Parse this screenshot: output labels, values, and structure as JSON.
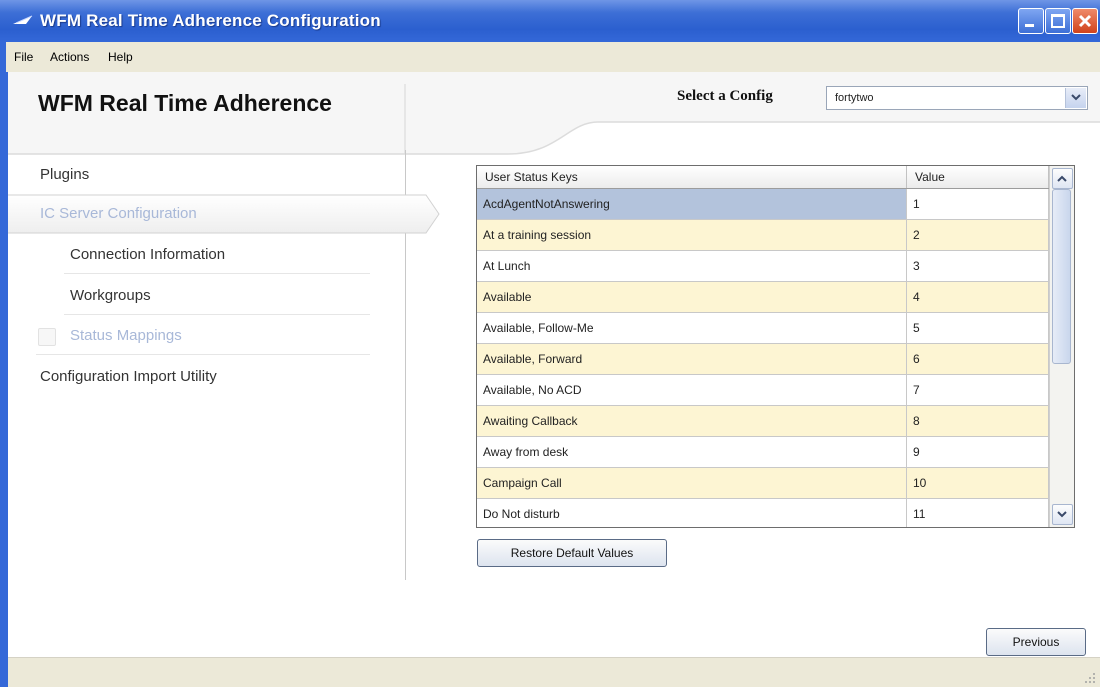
{
  "window": {
    "title": "WFM Real Time Adherence Configuration"
  },
  "menu": {
    "items": [
      "File",
      "Actions",
      "Help"
    ]
  },
  "header": {
    "title": "WFM Real Time Adherence",
    "select_label": "Select a Config",
    "config_value": "fortytwo"
  },
  "sidebar": {
    "items": [
      {
        "label": "Plugins"
      },
      {
        "label": "IC Server Configuration"
      },
      {
        "label": "Connection Information"
      },
      {
        "label": "Workgroups"
      },
      {
        "label": "Status Mappings"
      },
      {
        "label": "Configuration Import Utility"
      }
    ]
  },
  "table": {
    "columns": [
      "User Status Keys",
      "Value"
    ],
    "rows": [
      {
        "key": "AcdAgentNotAnswering",
        "value": "1"
      },
      {
        "key": "At a training session",
        "value": "2"
      },
      {
        "key": "At Lunch",
        "value": "3"
      },
      {
        "key": "Available",
        "value": "4"
      },
      {
        "key": "Available, Follow-Me",
        "value": "5"
      },
      {
        "key": "Available, Forward",
        "value": "6"
      },
      {
        "key": "Available, No ACD",
        "value": "7"
      },
      {
        "key": "Awaiting Callback",
        "value": "8"
      },
      {
        "key": "Away from desk",
        "value": "9"
      },
      {
        "key": "Campaign Call",
        "value": "10"
      },
      {
        "key": "Do Not disturb",
        "value": "11"
      }
    ],
    "selected_row": 0
  },
  "buttons": {
    "restore": "Restore Default Values",
    "previous": "Previous"
  },
  "colors": {
    "titlebar": "#3468d8",
    "row_alt": "#fdf5d3",
    "row_selected": "#b3c3dc",
    "nav_inactive": "#a8b8d8"
  }
}
